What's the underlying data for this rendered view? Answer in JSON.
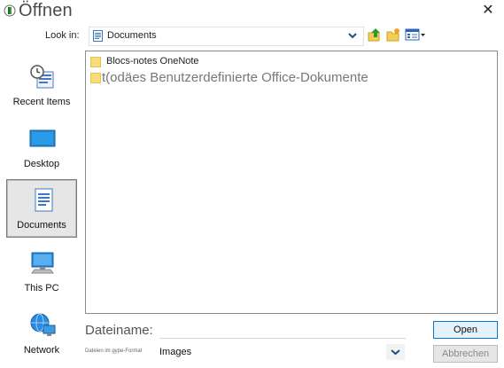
{
  "window": {
    "title": "Öffnen",
    "close_glyph": "✕"
  },
  "lookin": {
    "label": "Look in:",
    "value": "Documents",
    "icon": "documents-folder-icon"
  },
  "toolbar": {
    "icons": [
      "up-folder-icon",
      "new-folder-icon",
      "view-menu-icon"
    ]
  },
  "places": [
    {
      "label": "Recent Items",
      "icon": "recent-items-icon",
      "selected": false
    },
    {
      "label": "Desktop",
      "icon": "desktop-icon",
      "selected": false
    },
    {
      "label": "Documents",
      "icon": "documents-icon",
      "selected": true
    },
    {
      "label": "This PC",
      "icon": "computer-icon",
      "selected": false
    },
    {
      "label": "Network",
      "icon": "network-icon",
      "selected": false
    }
  ],
  "files": [
    {
      "name": "Blocs-notes OneNote",
      "type": "folder"
    },
    {
      "name": "t(odäes Benutzerdefinierte Office-Dokumente",
      "type": "folder"
    }
  ],
  "filename": {
    "label": "Dateiname:",
    "value": ""
  },
  "filetype": {
    "label": "Dateien im gype-Format",
    "value": "Images"
  },
  "buttons": {
    "open": "Open",
    "cancel": "Abbrechen"
  },
  "colors": {
    "accent": "#0078d7",
    "folder": "#f7dc7a",
    "selected_bg": "#e6e6e6"
  }
}
